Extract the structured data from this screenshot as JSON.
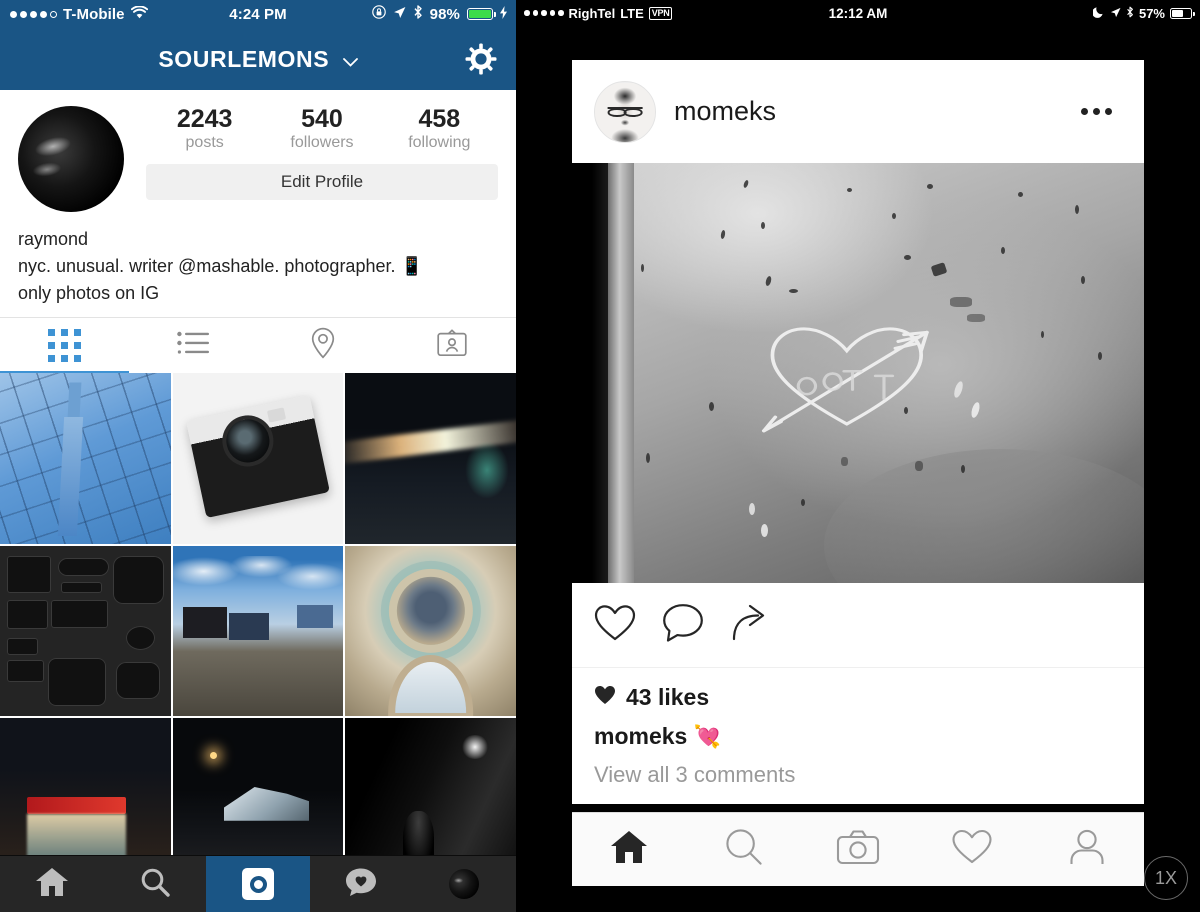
{
  "left_phone": {
    "status_bar": {
      "carrier": "T-Mobile",
      "signal_dots_filled": 4,
      "signal_dots_total": 5,
      "wifi_icon": "wifi-icon",
      "time": "4:24 PM",
      "rotation_lock_icon": "rotation-lock-icon",
      "location_icon": "location-arrow-icon",
      "bluetooth_icon": "bluetooth-icon",
      "battery_percent": "98%",
      "battery_level": 98,
      "battery_color": "#3ddc4a",
      "charging_icon": "lightning-bolt-icon"
    },
    "nav_bar": {
      "title": "SOURLEMONS",
      "chevron": "⌄",
      "settings_icon": "gear-icon",
      "background_color": "#1a5585"
    },
    "profile": {
      "avatar": "profile-avatar-dark",
      "stats": [
        {
          "number": "2243",
          "label": "posts"
        },
        {
          "number": "540",
          "label": "followers"
        },
        {
          "number": "458",
          "label": "following"
        }
      ],
      "edit_button": "Edit Profile",
      "name": "raymond",
      "bio_line1": "nyc. unusual. writer @mashable. photographer. 📱",
      "bio_line2": "only photos on IG"
    },
    "view_tabs": [
      {
        "name": "grid-view-tab",
        "icon": "grid-icon",
        "active": true
      },
      {
        "name": "list-view-tab",
        "icon": "list-icon",
        "active": false
      },
      {
        "name": "photo-map-tab",
        "icon": "location-pin-icon",
        "active": false
      },
      {
        "name": "photos-of-you-tab",
        "icon": "tagged-photos-icon",
        "active": false
      }
    ],
    "photo_grid": [
      {
        "id": "p1",
        "alt": "blue glass skyscraper facade with One World Trade tower"
      },
      {
        "id": "p2",
        "alt": "Olympus PEN camera on white background"
      },
      {
        "id": "p3",
        "alt": "night street with car light trails"
      },
      {
        "id": "p4",
        "alt": "flat-lay of camera gear on dark surface"
      },
      {
        "id": "p5",
        "alt": "rail yard and city skyline under blue sky"
      },
      {
        "id": "p6",
        "alt": "ornate painted dome ceiling interior"
      },
      {
        "id": "p7",
        "alt": "lit newsstand kiosk at night"
      },
      {
        "id": "p8",
        "alt": "modern angular building at night with street lamps"
      },
      {
        "id": "p9",
        "alt": "black and white rainy night street"
      }
    ],
    "tab_bar": {
      "background_color": "#262626",
      "active_color": "#1a5585",
      "items": [
        {
          "name": "home-tab",
          "icon": "home-icon",
          "active": false
        },
        {
          "name": "search-tab",
          "icon": "search-icon",
          "active": false
        },
        {
          "name": "camera-tab",
          "icon": "camera-circle-icon",
          "active": true
        },
        {
          "name": "activity-tab",
          "icon": "heart-speech-bubble-icon",
          "active": false
        },
        {
          "name": "profile-tab",
          "icon": "profile-avatar-icon",
          "active": false
        }
      ]
    }
  },
  "right_phone": {
    "status_bar": {
      "carrier": "RighTel",
      "network": "LTE",
      "vpn_label": "VPN",
      "signal_dots_filled": 5,
      "signal_dots_total": 5,
      "time": "12:12 AM",
      "moon_icon": "moon-do-not-disturb-icon",
      "location_icon": "location-arrow-icon",
      "bluetooth_icon": "bluetooth-icon",
      "battery_percent": "57%",
      "battery_level": 57
    },
    "post": {
      "avatar": "user-avatar-bearded-man",
      "username": "momeks",
      "more_options_icon": "ellipsis-icon",
      "photo_alt": "black and white photo of a heart with an arrow scratched into a concrete wall",
      "actions": [
        {
          "name": "like-button",
          "icon": "heart-outline-icon"
        },
        {
          "name": "comment-button",
          "icon": "speech-bubble-icon"
        },
        {
          "name": "share-button",
          "icon": "share-arrow-icon"
        }
      ],
      "likes_icon": "heart-filled-icon",
      "likes_text": "43 likes",
      "likes_count": 43,
      "caption_user": "momeks",
      "caption_emoji": "💘",
      "view_comments": "View all 3 comments",
      "comments_count": 3
    },
    "tab_bar": {
      "background_color": "#fafafa",
      "items": [
        {
          "name": "home-tab",
          "icon": "home-filled-icon",
          "active": true
        },
        {
          "name": "search-tab",
          "icon": "search-icon",
          "active": false
        },
        {
          "name": "camera-tab",
          "icon": "camera-icon",
          "active": false
        },
        {
          "name": "activity-tab",
          "icon": "heart-outline-icon",
          "active": false
        },
        {
          "name": "profile-tab",
          "icon": "person-outline-icon",
          "active": false
        }
      ]
    },
    "zoom_badge": "1X"
  }
}
